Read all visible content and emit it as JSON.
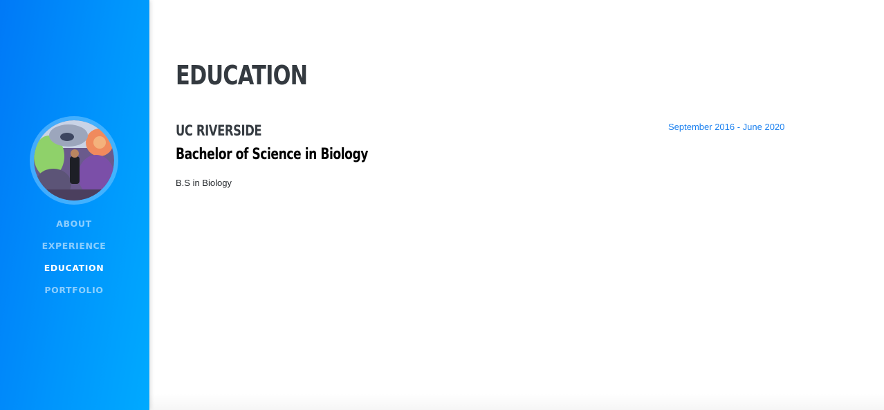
{
  "sidebar": {
    "nav": [
      {
        "label": "ABOUT",
        "active": false
      },
      {
        "label": "EXPERIENCE",
        "active": false
      },
      {
        "label": "EDUCATION",
        "active": true
      },
      {
        "label": "PORTFOLIO",
        "active": false
      }
    ]
  },
  "main": {
    "title": "EDUCATION",
    "entries": [
      {
        "school": "UC RIVERSIDE",
        "degree": "Bachelor of Science in Biology",
        "description": "B.S in Biology",
        "dates": "September 2016 - June 2020"
      }
    ]
  },
  "colors": {
    "sidebar_start": "#0079f7",
    "sidebar_end": "#00aaff",
    "heading": "#343a40",
    "date_accent": "#1b80ef"
  }
}
